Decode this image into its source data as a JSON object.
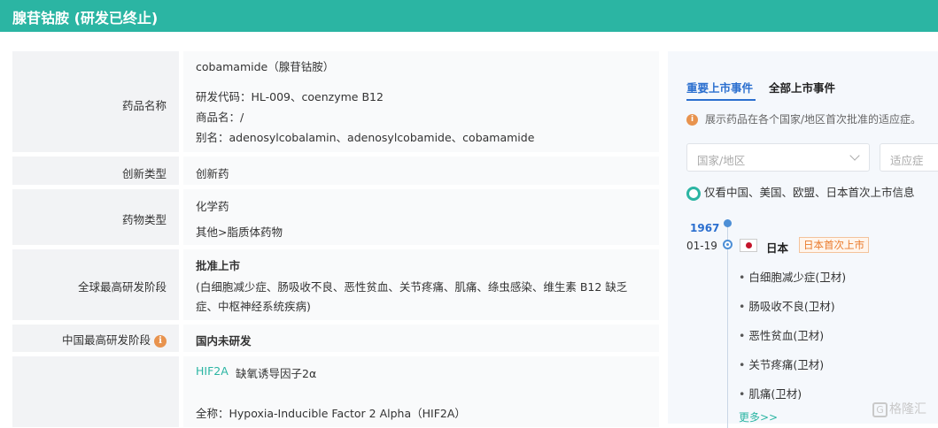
{
  "header": {
    "title": "腺苷钴胺 (研发已终止)"
  },
  "rows": {
    "drug_name": {
      "label": "药品名称",
      "generic": "cobamamide（腺苷钴胺）",
      "code": "研发代码：HL-009、coenzyme B12",
      "trade": "商品名：/",
      "alias": "别名：adenosylcobalamin、adenosylcobamide、cobamamide"
    },
    "innovation": {
      "label": "创新类型",
      "value": "创新药"
    },
    "drug_type": {
      "label": "药物类型",
      "line1": "化学药",
      "line2": "其他>脂质体药物"
    },
    "global_stage": {
      "label": "全球最高研发阶段",
      "status": "批准上市",
      "line1": "(白细胞减少症、肠吸收不良、恶性贫血、关节疼痛、肌痛、绦虫感染、维生素 B12 缺乏",
      "line2": "症、中枢神经系统疾病)"
    },
    "china_stage": {
      "label": "中国最高研发阶段",
      "value": "国内未研发"
    },
    "target": {
      "code": "HIF2A",
      "desc": "缺氧诱导因子2α",
      "fullname": "全称：Hypoxia-Inducible Factor 2 Alpha（HIF2A）"
    }
  },
  "panel": {
    "tabs": [
      "重要上市事件",
      "全部上市事件"
    ],
    "notice": "展示药品在各个国家/地区首次批准的适应症。",
    "filters": {
      "country_placeholder": "国家/地区",
      "indication_placeholder": "适应症"
    },
    "toggle_label": "仅看中国、美国、欧盟、日本首次上市信息",
    "timeline": {
      "year": "1967",
      "date": "01-19",
      "country": "日本",
      "badge": "日本首次上市",
      "indications": [
        "白细胞减少症(卫材)",
        "肠吸收不良(卫材)",
        "恶性贫血(卫材)",
        "关节疼痛(卫材)",
        "肌痛(卫材)"
      ],
      "more": "更多>>"
    }
  },
  "watermark": "格隆汇",
  "colors": {
    "header": "#2bb5a3",
    "accent_blue": "#2b6fcf",
    "badge_orange": "#ea7b2d"
  }
}
